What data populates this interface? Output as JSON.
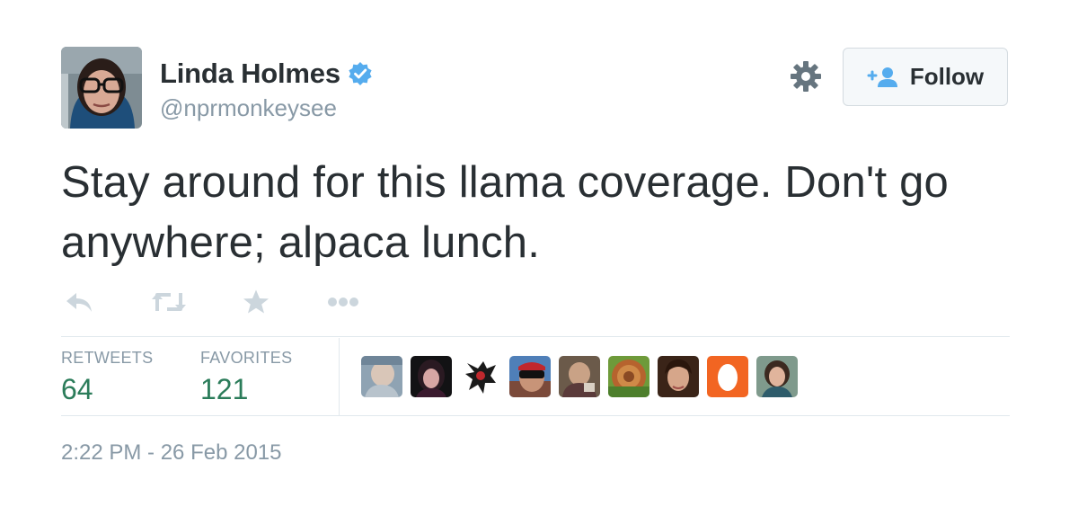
{
  "user": {
    "display_name": "Linda Holmes",
    "handle": "@nprmonkeysee",
    "verified": true
  },
  "follow_button": {
    "label": "Follow",
    "icon": "add-user-icon"
  },
  "settings_icon": "gear-icon",
  "tweet": {
    "text": "Stay around for this llama coverage. Don't go anywhere; alpaca lunch."
  },
  "actions": [
    {
      "name": "reply",
      "icon": "reply-icon"
    },
    {
      "name": "retweet",
      "icon": "retweet-icon"
    },
    {
      "name": "favorite",
      "icon": "star-icon"
    },
    {
      "name": "more",
      "icon": "more-dots-icon"
    }
  ],
  "stats": {
    "retweets_label": "RETWEETS",
    "retweets_value": "64",
    "favorites_label": "FAVORITES",
    "favorites_value": "121"
  },
  "favoriters_count_shown": 9,
  "timestamp": "2:22 PM - 26 Feb 2015",
  "colors": {
    "text": "#292f33",
    "muted": "#8899a6",
    "verified_blue": "#55acee",
    "stat_green": "#2b7c5a",
    "divider": "#e1e8ed"
  }
}
